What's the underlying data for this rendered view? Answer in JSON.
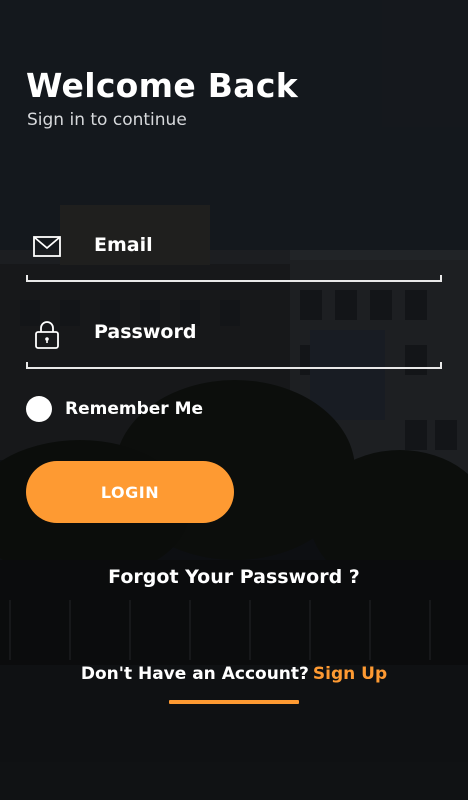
{
  "header": {
    "title": "Welcome Back",
    "subtitle": "Sign in to continue"
  },
  "form": {
    "email": {
      "placeholder": "Email",
      "icon": "mail-icon"
    },
    "password": {
      "placeholder": "Password",
      "icon": "lock-icon"
    },
    "remember_label": "Remember Me",
    "login_label": "LOGIN"
  },
  "links": {
    "forgot_password": "Forgot Your Password ?",
    "no_account_prompt": "Don't Have an Account?",
    "sign_up": "Sign Up"
  },
  "colors": {
    "accent": "#fe9a32",
    "text": "#ffffff",
    "background": "#1a1d22"
  }
}
